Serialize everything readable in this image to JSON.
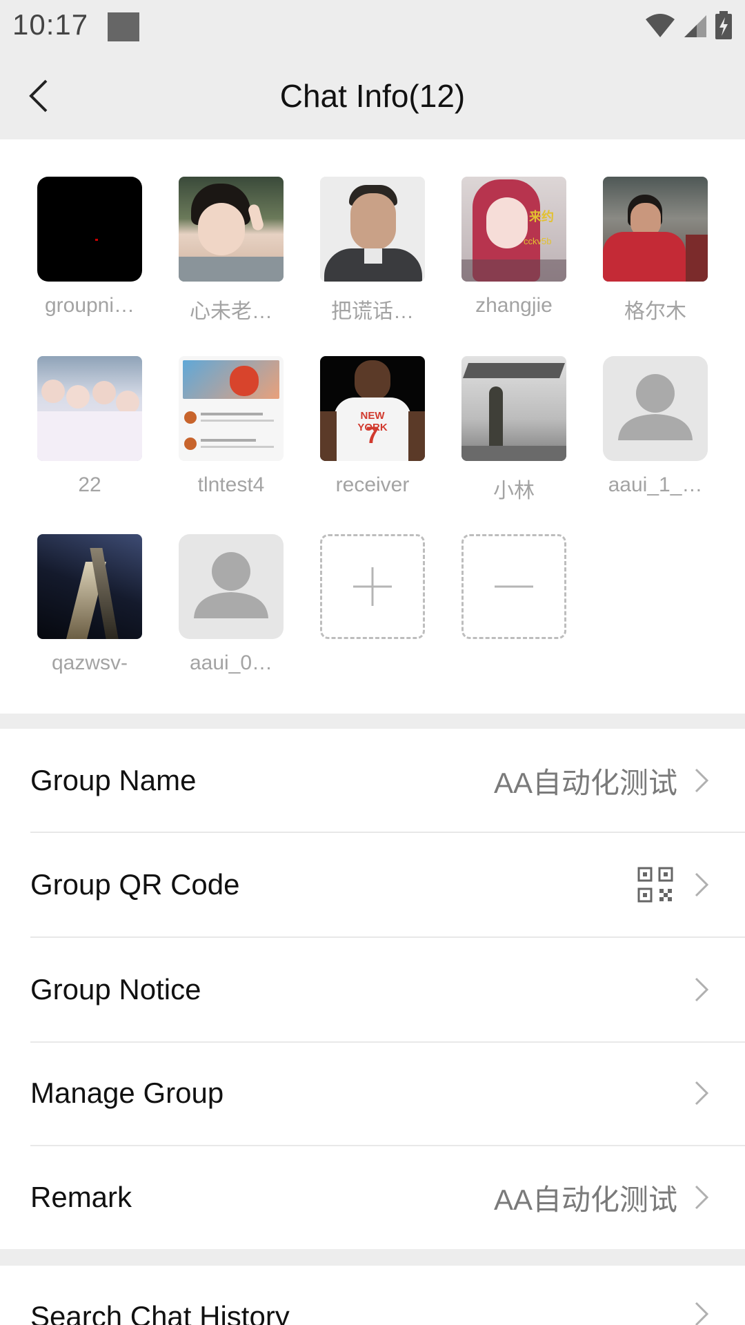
{
  "status_bar": {
    "time": "10:17"
  },
  "header": {
    "title": "Chat Info(12)"
  },
  "members": [
    {
      "name": "groupni…",
      "avatar": "black-avatar"
    },
    {
      "name": "心未老…",
      "avatar": "photo-girl-peace-sign"
    },
    {
      "name": "把谎话…",
      "avatar": "photo-man-portrait"
    },
    {
      "name": "zhangjie",
      "avatar": "photo-girl-pink-hair"
    },
    {
      "name": "格尔木",
      "avatar": "photo-woman-red-jacket"
    },
    {
      "name": "22",
      "avatar": "photo-group-girls"
    },
    {
      "name": "tlntest4",
      "avatar": "photo-cartoon-screenshot"
    },
    {
      "name": "receiver",
      "avatar": "photo-basketball-player"
    },
    {
      "name": "小林",
      "avatar": "photo-soldier-jets"
    },
    {
      "name": "aaui_1_…",
      "avatar": "default-person-avatar"
    },
    {
      "name": "qazwsv-",
      "avatar": "photo-night-skyscraper"
    },
    {
      "name": "aaui_0…",
      "avatar": "default-person-avatar"
    }
  ],
  "actions": {
    "add_icon": "plus-icon",
    "remove_icon": "minus-icon"
  },
  "settings": {
    "group_name": {
      "label": "Group Name",
      "value": "AA自动化测试"
    },
    "group_qr": {
      "label": "Group QR Code",
      "icon": "qr-code-icon"
    },
    "group_notice": {
      "label": "Group Notice"
    },
    "manage_group": {
      "label": "Manage Group"
    },
    "remark": {
      "label": "Remark",
      "value": "AA自动化测试"
    }
  },
  "search": {
    "label": "Search Chat History"
  },
  "colors": {
    "background": "#ededed",
    "panel": "#ffffff",
    "muted_text": "#a3a3a3",
    "value_text": "#7a7a7a"
  }
}
